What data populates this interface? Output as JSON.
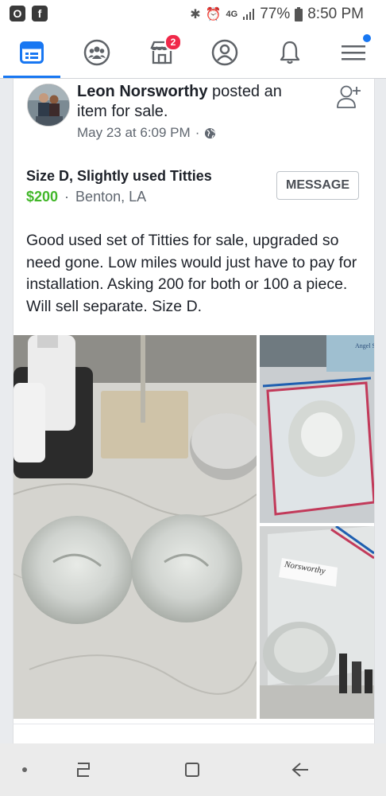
{
  "status_bar": {
    "network": "4G",
    "battery": "77%",
    "time": "8:50 PM",
    "app_icons": [
      "o-icon",
      "facebook-icon"
    ],
    "system_icons": [
      "bluetooth-icon",
      "alarm-icon",
      "signal-icon",
      "battery-icon"
    ]
  },
  "nav": {
    "marketplace_badge": "2",
    "items": [
      "news-feed",
      "groups",
      "marketplace",
      "profile",
      "notifications",
      "menu"
    ]
  },
  "post": {
    "author": "Leon Norsworthy",
    "action": " posted an item for sale.",
    "timestamp": "May 23 at 6:09 PM",
    "separator": "·",
    "listing": {
      "title": "Size D, Slightly used Titties",
      "price": "$200",
      "separator": "·",
      "location": "Benton, LA",
      "message_button": "MESSAGE"
    },
    "description": "Good used set of Titties for sale, upgraded so need gone. Low miles would just have to pay for installation. Asking 200 for both or 100 a piece. Will sell separate. Size D.",
    "photo_labels": {
      "bottle_text": "Angel Soft",
      "bag_text": "Norsworthy"
    }
  },
  "colors": {
    "accent": "#1877f2",
    "price": "#42b72a",
    "badge": "#f02849"
  }
}
